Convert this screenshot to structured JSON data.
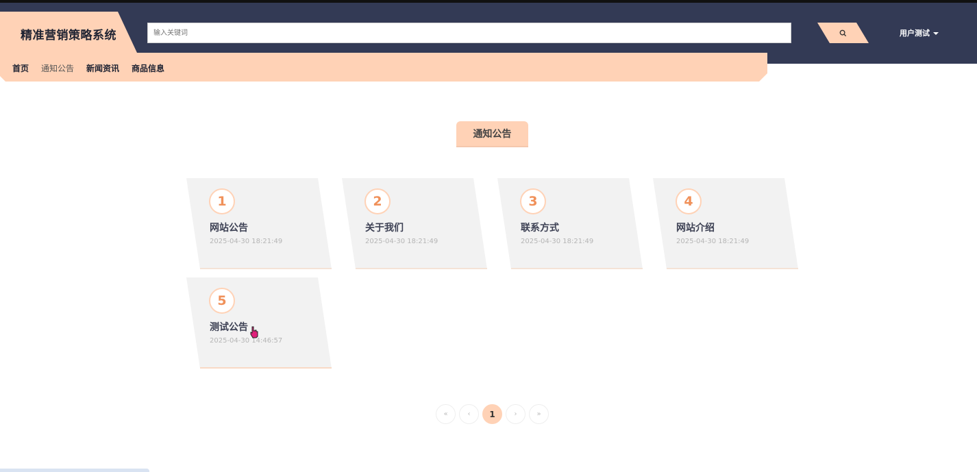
{
  "header": {
    "logo": "精准营销策略系统",
    "search_placeholder": "输入关键词",
    "user_label": "用户测试"
  },
  "nav": {
    "items": [
      {
        "label": "首页"
      },
      {
        "label": "通知公告"
      },
      {
        "label": "新闻资讯"
      },
      {
        "label": "商品信息"
      }
    ],
    "active_index": 1
  },
  "main": {
    "section_title": "通知公告",
    "cards": [
      {
        "num": "1",
        "title": "网站公告",
        "date": "2025-04-30 18:21:49"
      },
      {
        "num": "2",
        "title": "关于我们",
        "date": "2025-04-30 18:21:49"
      },
      {
        "num": "3",
        "title": "联系方式",
        "date": "2025-04-30 18:21:49"
      },
      {
        "num": "4",
        "title": "网站介绍",
        "date": "2025-04-30 18:21:49"
      },
      {
        "num": "5",
        "title": "测试公告",
        "date": "2025-04-30 14:46:57"
      }
    ]
  },
  "pagination": {
    "first": "«",
    "prev": "‹",
    "current": "1",
    "next": "›",
    "last": "»"
  },
  "colors": {
    "header_bg": "#333a55",
    "accent": "#ffd2b6",
    "number": "#f0915a"
  }
}
